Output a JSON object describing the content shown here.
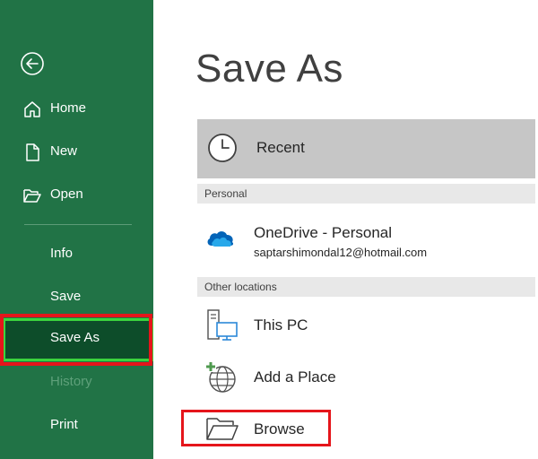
{
  "sidebar": {
    "back_icon": "back-arrow-icon",
    "items": [
      {
        "label": "Home",
        "icon": "home-icon"
      },
      {
        "label": "New",
        "icon": "new-file-icon"
      },
      {
        "label": "Open",
        "icon": "folder-open-icon"
      },
      {
        "label": "Info"
      },
      {
        "label": "Save"
      },
      {
        "label": "Save As",
        "active": true
      },
      {
        "label": "History",
        "disabled": true
      },
      {
        "label": "Print"
      }
    ]
  },
  "main": {
    "title": "Save As",
    "recent": {
      "label": "Recent",
      "icon": "clock-icon"
    },
    "sections": [
      {
        "header": "Personal",
        "locations": [
          {
            "title": "OneDrive - Personal",
            "subtitle": "saptarshimondal12@hotmail.com",
            "icon": "onedrive-cloud-icon"
          }
        ]
      },
      {
        "header": "Other locations",
        "locations": [
          {
            "title": "This PC",
            "icon": "this-pc-icon"
          },
          {
            "title": "Add a Place",
            "icon": "add-place-globe-icon"
          },
          {
            "title": "Browse",
            "icon": "folder-browse-icon"
          }
        ]
      }
    ]
  },
  "colors": {
    "sidebar_bg": "#217346",
    "active_bg": "#0d4d2a",
    "highlight_red": "#e5151b",
    "highlight_green": "#3bd43e",
    "recent_bg": "#c6c6c6",
    "section_bg": "#e8e8e8"
  }
}
